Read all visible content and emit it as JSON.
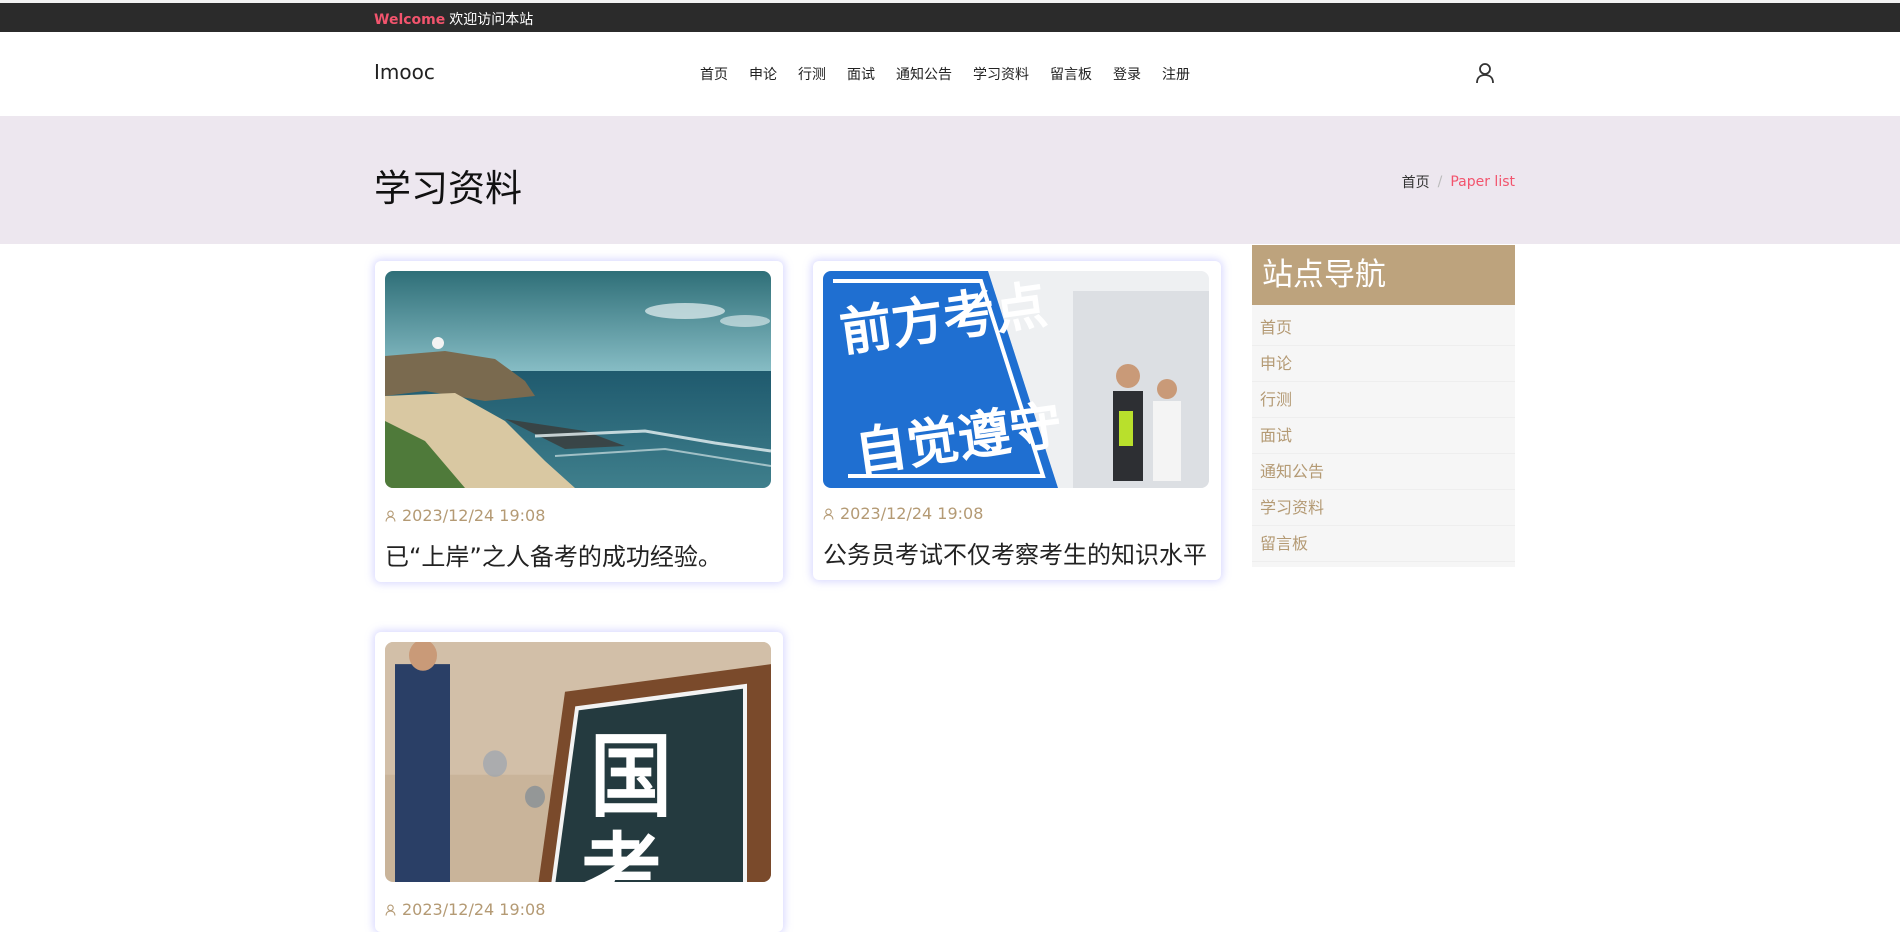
{
  "topbar": {
    "welcome_word": "Welcome",
    "welcome_message": "欢迎访问本站"
  },
  "header": {
    "brand": "Imooc",
    "nav": [
      "首页",
      "申论",
      "行测",
      "面试",
      "通知公告",
      "学习资料",
      "留言板",
      "登录",
      "注册"
    ],
    "user_icon": "user-icon"
  },
  "title_band": {
    "page_title": "学习资料",
    "breadcrumb": {
      "home": "首页",
      "separator": "/",
      "current": "Paper list"
    }
  },
  "cards": [
    {
      "image": "coastline-photo",
      "date": "2023/12/24 19:08",
      "title": "已“上岸”之人备考的成功经验。"
    },
    {
      "image": "exam-sign-photo",
      "date": "2023/12/24 19:08",
      "title": "公务员考试不仅考察考生的知识水平"
    },
    {
      "image": "guokao-board-photo",
      "date": "2023/12/24 19:08",
      "title": ""
    }
  ],
  "photo_text": {
    "sign_line1": "前方考点",
    "sign_line2": "自觉遵守",
    "board_line1": "国",
    "board_line2": "考"
  },
  "sidebar": {
    "heading": "站点导航",
    "items": [
      "首页",
      "申论",
      "行测",
      "面试",
      "通知公告",
      "学习资料",
      "留言板"
    ]
  },
  "colors": {
    "accent_pink": "#f2546d",
    "accent_gold": "#bda37d",
    "band_bg": "#ede7ef"
  }
}
